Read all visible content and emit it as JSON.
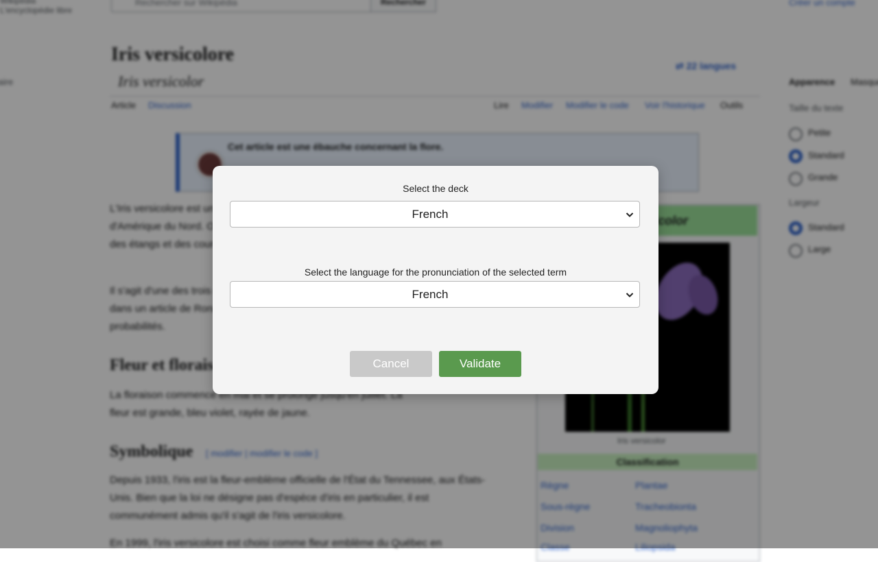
{
  "background_page": {
    "header": {
      "left_line1": "Wikipédia",
      "left_line2": "L'encyclopédie libre",
      "search_placeholder": "Rechercher sur Wikipédia",
      "search_button": "Rechercher",
      "create_account": "Créer un compte"
    },
    "title": "Iris versicolore",
    "subtitle": "Iris versicolor",
    "left_sidebar_text": "Sommaire",
    "languages_button": "22 langues",
    "tabs": [
      "Article",
      "Discussion",
      "Lire",
      "Modifier",
      "Modifier le code",
      "Voir l'historique",
      "Outils"
    ],
    "notice": "Cet article est une ébauche concernant la flore.",
    "intro_lines": [
      "L'Iris versicolore est une espèce de plantes de la famille des Iridacées originaire",
      "d'Amérique du Nord. On la trouve à l'état sauvage dans des prés humides, au bord",
      "des étangs et des cours d'eau.",
      "Il s'agit d'une des trois espèces d'iris étudiées par Edgar Anderson et utilisées",
      "dans un article de Ronald Fisher en 1936, devenu célèbre en statistique et en",
      "probabilités."
    ],
    "section1_title": "Fleur et floraison",
    "section1_lines": [
      "La floraison commence en mai et se prolonge jusqu'en juillet. La",
      "fleur est grande, bleu violet, rayée de jaune."
    ],
    "section2_title": "Symbolique",
    "section2_edit": "[ modifier | modifier le code ]",
    "section2_lines": [
      "Depuis 1933, l'iris est la fleur-emblème officielle de l'État du Tennessee, aux États-",
      "Unis. Bien que la loi ne désigne pas d'espèce d'iris en particulier, il est",
      "communément admis qu'il s'agit de l'iris versicolore."
    ],
    "section2_last_line": "En 1999, l'iris versicolore est choisi comme fleur emblème du Québec en",
    "infobox": {
      "header": "Iris versicolor",
      "caption": "Iris versicolor",
      "classification_header": "Classification",
      "rows": [
        {
          "label": "Règne",
          "value": "Plantae"
        },
        {
          "label": "Sous-règne",
          "value": "Tracheobionta"
        },
        {
          "label": "Division",
          "value": "Magnoliophyta"
        },
        {
          "label": "Classe",
          "value": "Liliopsida"
        }
      ]
    },
    "right_sidebar": {
      "title": "Apparence",
      "hide": "Masquer",
      "text_size_label": "Taille du texte",
      "size_options": [
        "Petite",
        "Standard",
        "Grande"
      ],
      "width_label": "Largeur",
      "width_options": [
        "Standard",
        "Large"
      ]
    }
  },
  "modal": {
    "deck_label": "Select the deck",
    "deck_value": "French",
    "language_label": "Select the language for the pronunciation of the selected term",
    "language_value": "French",
    "cancel_label": "Cancel",
    "validate_label": "Validate"
  },
  "colors": {
    "overlay": "rgba(0,0,0,0.42)",
    "modal_bg": "#f4f4f4",
    "validate_button": "#5a9a4e",
    "cancel_button": "#c9c9c9",
    "link": "#3366cc"
  }
}
